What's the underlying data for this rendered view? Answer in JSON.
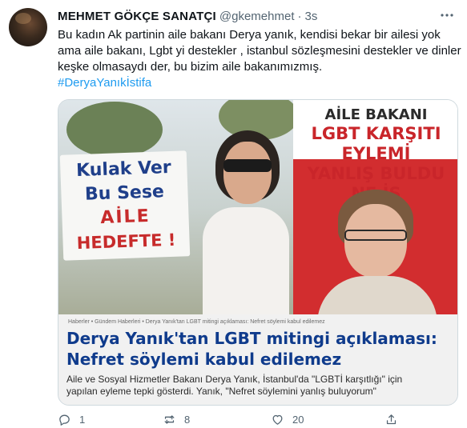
{
  "tweet": {
    "author_name": "MEHMET GÖKÇE SANATÇI",
    "author_handle": "@gkemehmet",
    "separator": "·",
    "time": "3s",
    "text_lines": [
      "Bu kadın Ak partinin aile bakanı Derya yanık, kendisi bekar bir ailesi yok",
      "ama aile bakanı, Lgbt yi destekler , istanbul sözleşmesini destekler ve dinler",
      "keşke olmasaydı der, bu bizim aile bakanımızmış."
    ],
    "hashtag": "#DeryaYanıkİstifa"
  },
  "media": {
    "sign": {
      "line1": "Kulak Ver",
      "line2": "Bu Sese",
      "line3": "AİLE",
      "line4": "HEDEFTE !"
    },
    "poster": {
      "line1": "AİLE BAKANI",
      "line2": "LGBT KARŞITI",
      "line3": "EYLEMİ",
      "line4": "YANLIŞ BULDU",
      "line5": "NE İS"
    },
    "article": {
      "breadcrumb": "Haberler  •  Gündem Haberleri  •  Derya Yanık'tan LGBT mitingi açıklaması: Nefret söylemi kabul edilemez",
      "title_lines": [
        "Derya Yanık'tan LGBT mitingi açıklaması:",
        "Nefret söylemi kabul edilemez"
      ],
      "body_lines": [
        "Aile ve Sosyal Hizmetler Bakanı Derya Yanık, İstanbul'da \"LGBTİ karşıtlığı\" için",
        "yapılan eyleme tepki gösterdi. Yanık, \"Nefret söylemini yanlış buluyorum\""
      ]
    }
  },
  "actions": {
    "reply_count": "1",
    "retweet_count": "8",
    "like_count": "20",
    "reply_icon": "reply-icon",
    "retweet_icon": "retweet-icon",
    "like_icon": "heart-icon",
    "share_icon": "share-icon"
  },
  "colors": {
    "link": "#1d9bf0",
    "secondary_text": "#536471",
    "primary_text": "#0f1419"
  }
}
